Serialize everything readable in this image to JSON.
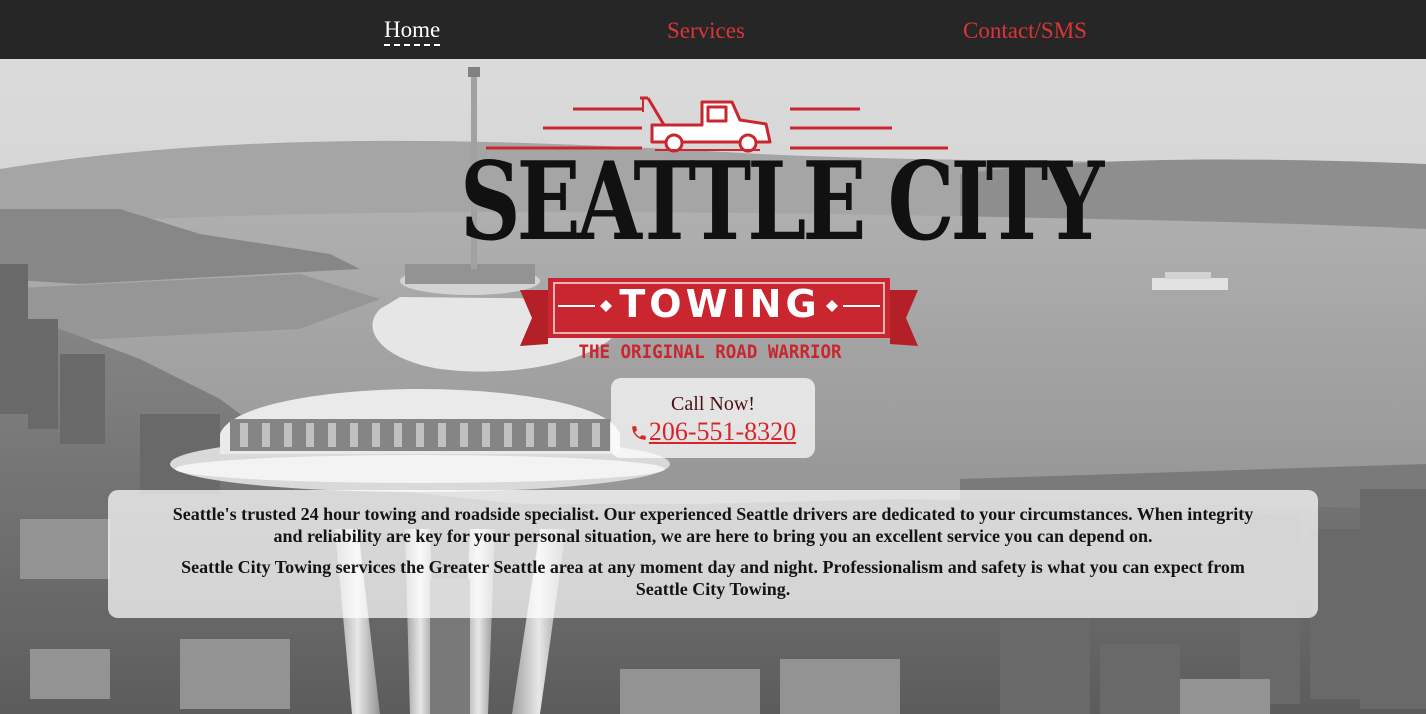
{
  "nav": {
    "items": [
      {
        "label": "Home",
        "active": true
      },
      {
        "label": "Services",
        "active": false
      },
      {
        "label": "Contact/SMS",
        "active": false
      }
    ]
  },
  "logo": {
    "title": "SEATTLE CITY",
    "banner": "TOWING",
    "tagline": "THE ORIGINAL ROAD WARRIOR"
  },
  "call": {
    "label": "Call Now!",
    "phone": "206-551-8320",
    "icon": "phone-icon"
  },
  "intro": {
    "paragraph1": "Seattle's trusted 24 hour towing and roadside specialist. Our experienced Seattle drivers are dedicated to your circumstances. When integrity and reliability are key for your personal situation, we are here to bring you an excellent service you can depend on.",
    "paragraph2": "Seattle City Towing services the Greater Seattle area at any moment day and night. Professionalism and safety is what you can expect from Seattle City Towing."
  },
  "colors": {
    "nav_bg": "#262626",
    "accent_red": "#d9363a",
    "brand_red": "#c9262f"
  }
}
